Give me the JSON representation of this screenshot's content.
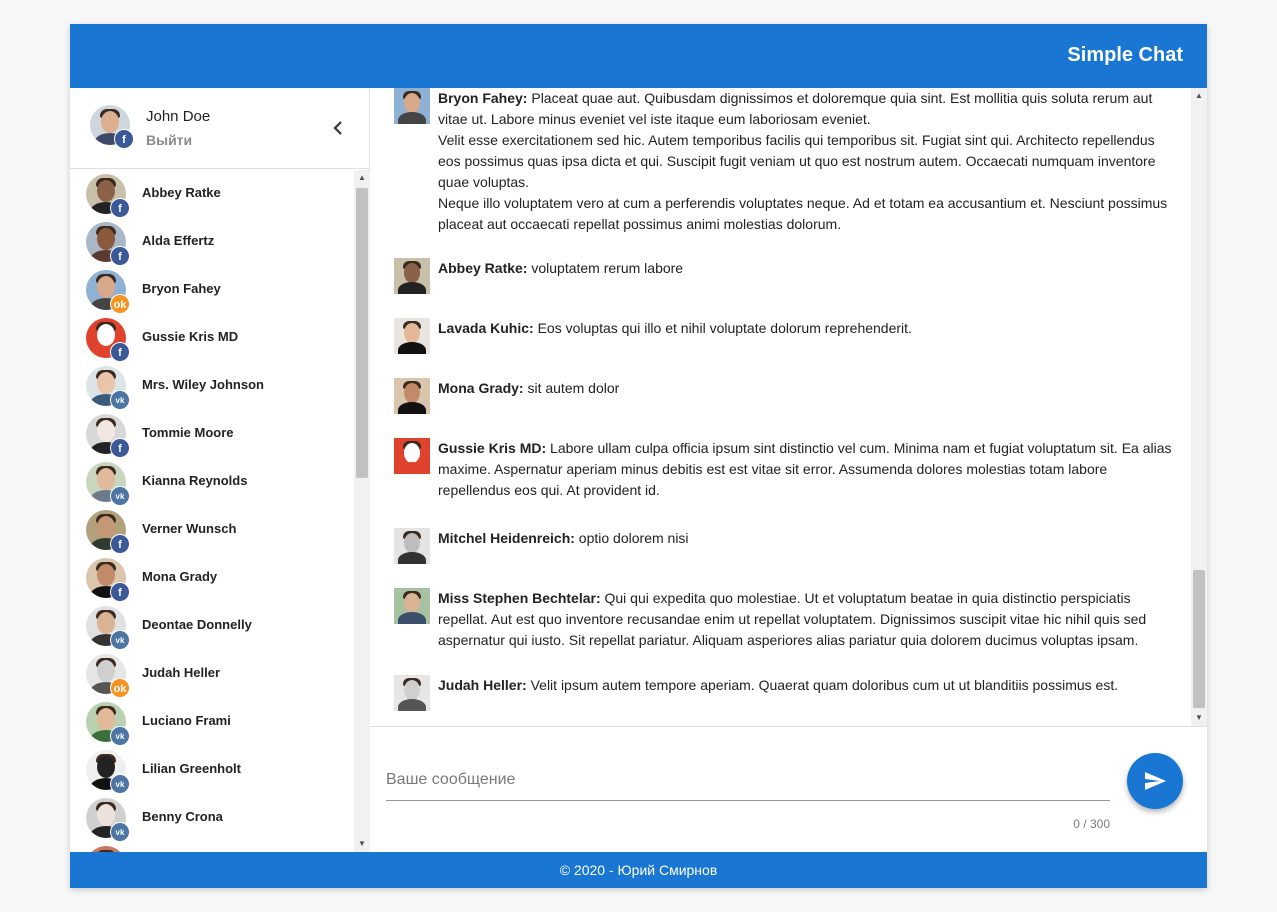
{
  "app": {
    "title": "Simple Chat"
  },
  "profile": {
    "name": "John Doe",
    "logout_label": "Выйти",
    "network": "fb",
    "skin": "#dcb08f",
    "shirt": "#3d4b66"
  },
  "contacts": [
    {
      "name": "Abbey Ratke",
      "network": "fb",
      "bg": "#c9c0a9",
      "skin": "#8a6247",
      "shirt": "#222"
    },
    {
      "name": "Alda Effertz",
      "network": "fb",
      "bg": "#a9b8c9",
      "skin": "#8b5a3c",
      "shirt": "#5c3a2e"
    },
    {
      "name": "Bryon Fahey",
      "network": "ok",
      "bg": "#8fb1d6",
      "skin": "#d7a98a",
      "shirt": "#444"
    },
    {
      "name": "Gussie Kris MD",
      "network": "fb",
      "bg": "#e0432d",
      "skin": "#ffffff",
      "shirt": "#e0432d"
    },
    {
      "name": "Mrs. Wiley Johnson",
      "network": "vk",
      "bg": "#dde4e8",
      "skin": "#e9c4a8",
      "shirt": "#3a5a7a"
    },
    {
      "name": "Tommie Moore",
      "network": "fb",
      "bg": "#d8d8d8",
      "skin": "#f2e7e2",
      "shirt": "#222"
    },
    {
      "name": "Kianna Reynolds",
      "network": "vk",
      "bg": "#c8d6c0",
      "skin": "#e0b89a",
      "shirt": "#6b7a8a"
    },
    {
      "name": "Verner Wunsch",
      "network": "fb",
      "bg": "#b2a17c",
      "skin": "#c69776",
      "shirt": "#2e3b2e"
    },
    {
      "name": "Mona Grady",
      "network": "fb",
      "bg": "#d9c6ad",
      "skin": "#c28a68",
      "shirt": "#111"
    },
    {
      "name": "Deontae Donnelly",
      "network": "vk",
      "bg": "#e1e1e1",
      "skin": "#d9b394",
      "shirt": "#333"
    },
    {
      "name": "Judah Heller",
      "network": "ok",
      "bg": "#e6e6e6",
      "skin": "#cfcfcf",
      "shirt": "#555"
    },
    {
      "name": "Luciano Frami",
      "network": "vk",
      "bg": "#b9d1b0",
      "skin": "#e3b896",
      "shirt": "#3b6e3b"
    },
    {
      "name": "Lilian Greenholt",
      "network": "vk",
      "bg": "#efefef",
      "skin": "#222222",
      "shirt": "#111"
    },
    {
      "name": "Benny Crona",
      "network": "vk",
      "bg": "#d0d0d0",
      "skin": "#eee0dc",
      "shirt": "#222"
    },
    {
      "name": "",
      "network": "",
      "bg": "#c97a5e",
      "skin": "#d9a080",
      "shirt": "#333"
    }
  ],
  "messages": [
    {
      "author": "Bryon Fahey:",
      "text": " Placeat quae aut. Quibusdam dignissimos et doloremque quia sint. Est mollitia quis soluta rerum aut vitae ut. Labore minus eveniet vel iste itaque eum laboriosam eveniet.\nVelit esse exercitationem sed hic. Autem temporibus facilis qui temporibus sit. Fugiat sint qui. Architecto repellendus eos possimus quas ipsa dicta et qui. Suscipit fugit veniam ut quo est nostrum autem. Occaecati numquam inventore quae voluptas.\nNeque illo voluptatem vero at cum a perferendis voluptates neque. Ad et totam ea accusantium et. Nesciunt possimus placeat aut occaecati repellat possimus animi molestias dolorum.",
      "bg": "#8fb1d6",
      "skin": "#d7a98a",
      "shirt": "#444"
    },
    {
      "author": "Abbey Ratke:",
      "text": " voluptatem rerum labore",
      "bg": "#c9c0a9",
      "skin": "#8a6247",
      "shirt": "#222"
    },
    {
      "author": "Lavada Kuhic:",
      "text": " Eos voluptas qui illo et nihil voluptate dolorum reprehenderit.",
      "bg": "#e8e4df",
      "skin": "#e3b896",
      "shirt": "#111"
    },
    {
      "author": "Mona Grady:",
      "text": " sit autem dolor",
      "bg": "#d9c6ad",
      "skin": "#c28a68",
      "shirt": "#111"
    },
    {
      "author": "Gussie Kris MD:",
      "text": " Labore ullam culpa officia ipsum sint distinctio vel cum. Minima nam et fugiat voluptatum sit. Ea alias maxime. Aspernatur aperiam minus debitis est est vitae sit error. Assumenda dolores molestias totam labore repellendus eos qui. At provident id.",
      "bg": "#e0432d",
      "skin": "#ffffff",
      "shirt": "#e0432d"
    },
    {
      "author": "Mitchel Heidenreich:",
      "text": " optio dolorem nisi",
      "bg": "#e4e4e4",
      "skin": "#bdbdbd",
      "shirt": "#333"
    },
    {
      "author": "Miss Stephen Bechtelar:",
      "text": " Qui qui expedita quo molestiae. Ut et voluptatum beatae in quia distinctio perspiciatis repellat. Aut est quo inventore recusandae enim ut repellat voluptatem. Dignissimos suscipit vitae hic nihil quis sed aspernatur qui iusto. Sit repellat pariatur. Aliquam asperiores alias pariatur quia dolorem ducimus voluptas ipsam.",
      "bg": "#a7c2a0",
      "skin": "#d9b394",
      "shirt": "#3b4f6b"
    },
    {
      "author": "Judah Heller:",
      "text": " Velit ipsum autem tempore aperiam. Quaerat quam doloribus cum ut ut blanditiis possimus est.",
      "bg": "#e6e6e6",
      "skin": "#cfcfcf",
      "shirt": "#555"
    }
  ],
  "composer": {
    "placeholder": "Ваше сообщение",
    "counter": "0 / 300",
    "send_icon": "send-icon"
  },
  "footer": {
    "text": "© 2020 - Юрий Смирнов"
  },
  "colors": {
    "primary": "#1976d2",
    "facebook": "#3b5998",
    "vk": "#4c75a3",
    "ok": "#f7931e"
  }
}
